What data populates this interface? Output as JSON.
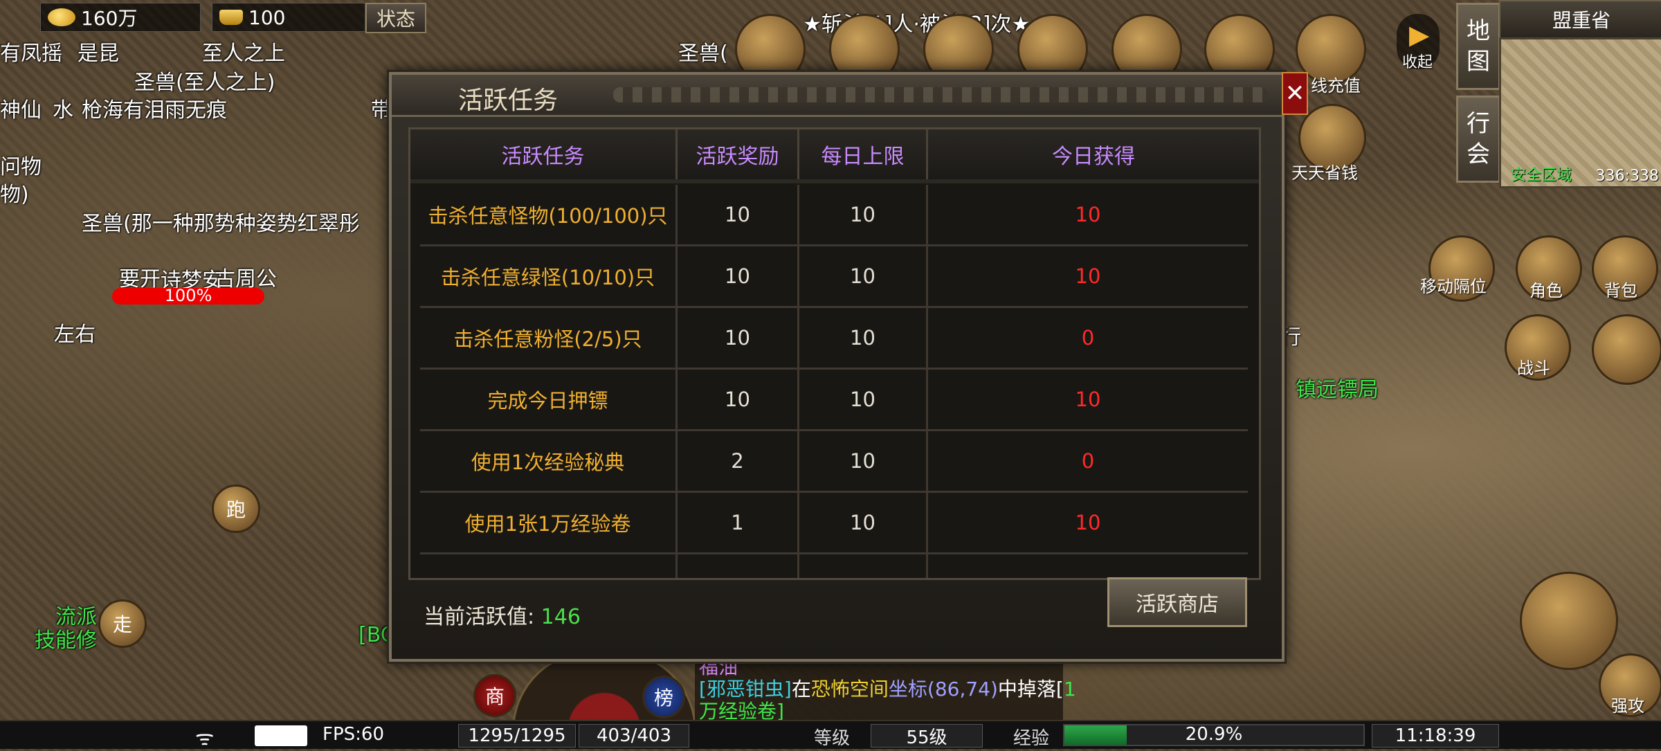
{
  "currency": {
    "gold": "160万",
    "ingot": "100",
    "state_btn": "状态"
  },
  "world_labels": {
    "l1": "有凤摇",
    "l2": "是昆",
    "l3": "至人之上",
    "l4": "圣兽(至人之上)",
    "l5": "神仙",
    "l6": "水",
    "l7": "枪海有泪雨无痕",
    "l8": "带",
    "l9": "问物",
    "l10": "物)",
    "l11": "圣兽(那一种那势种姿势红翠彤",
    "l12": "要开",
    "l13": "诗梦安",
    "l14": "古周公",
    "l15": "左右",
    "l16": "流派",
    "l17": "技能修",
    "l18": "[BC",
    "l19": "圣兽(",
    "l20": "★斩杀[1]人·被杀[2]次★",
    "l21": "镇远镖局",
    "l22": "行"
  },
  "player_hp_pct": "100%",
  "buttons": {
    "run": "跑",
    "walk": "走",
    "shop": "商",
    "rank": "榜"
  },
  "top_icons": {
    "recharge": "线充值",
    "daily": "天天省钱",
    "collapse": "收起"
  },
  "map": {
    "region": "盟重省",
    "tab_map": [
      "地",
      "图"
    ],
    "tab_guild": [
      "行",
      "会"
    ],
    "safe_zone": "安全区域",
    "coords": "336:338"
  },
  "right_icons": {
    "move": "移动隔位",
    "role": "角色",
    "bag": "背包",
    "battle": "战斗",
    "attack": "强攻"
  },
  "dialog": {
    "title": "活跃任务",
    "headers": [
      "活跃任务",
      "活跃奖励",
      "每日上限",
      "今日获得"
    ],
    "rows": [
      {
        "task": "击杀任意怪物(100/100)只",
        "reward": "10",
        "limit": "10",
        "today": "10"
      },
      {
        "task": "击杀任意绿怪(10/10)只",
        "reward": "10",
        "limit": "10",
        "today": "10"
      },
      {
        "task": "击杀任意粉怪(2/5)只",
        "reward": "10",
        "limit": "10",
        "today": "0"
      },
      {
        "task": "完成今日押镖",
        "reward": "10",
        "limit": "10",
        "today": "10"
      },
      {
        "task": "使用1次经验秘典",
        "reward": "2",
        "limit": "10",
        "today": "0"
      },
      {
        "task": "使用1张1万经验卷",
        "reward": "1",
        "limit": "10",
        "today": "10"
      }
    ],
    "active_label": "当前活跃值:",
    "active_value": "146",
    "shop_button": "活跃商店",
    "close": "✕"
  },
  "chat": {
    "line1": "福油",
    "line2_a": "[邪恶钳虫]",
    "line2_b": "在",
    "line2_c": "恐怖空间",
    "line2_d": "坐标(86,74)",
    "line2_e": "中掉落[",
    "line2_f": "1",
    "line3": "万经验卷]"
  },
  "status_bar": {
    "fps": "FPS:60",
    "hp": "1295/1295",
    "mp": "403/403",
    "level_label": "等级",
    "level": "55级",
    "exp_label": "经验",
    "exp": "20.9%",
    "exp_fraction": 0.209,
    "time": "11:18:39"
  }
}
